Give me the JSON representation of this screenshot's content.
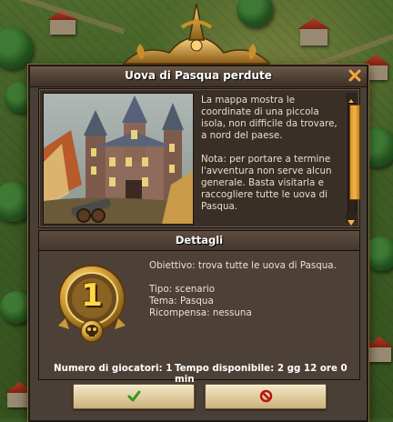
{
  "dialog": {
    "title": "Uova di Pasqua perdute",
    "description_paragraphs": [
      "La mappa mostra le coordinate di una piccola isola, non difficile da trovare, a nord del paese.",
      "Nota: per portare a termine l'avventura non serve alcun generale. Basta visitarla e raccogliere tutte le uova di Pasqua."
    ],
    "details_title": "Dettagli",
    "difficulty_number": "1",
    "objective": "Obiettivo: trova tutte le uova di Pasqua.",
    "type": "Tipo: scenario",
    "theme": "Tema: Pasqua",
    "reward": "Ricompensa: nessuna",
    "players": "Numero di giocatori: 1",
    "available_time": "Tempo disponibile: 2 gg 12 ore 0 min",
    "scroll_position": 0.08
  },
  "icons": {
    "close": "close-icon",
    "ok": "checkmark-icon",
    "cancel": "prohibited-icon",
    "medal": "skull-medal-icon"
  },
  "colors": {
    "accent_orange": "#f1b64c",
    "confirm_green": "#2f9a1e",
    "cancel_red": "#b8140d"
  }
}
